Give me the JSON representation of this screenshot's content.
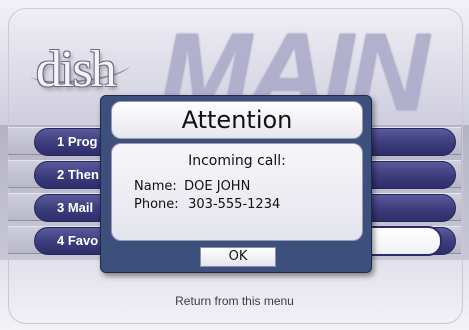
{
  "app": {
    "logo_text": "dish",
    "screen_title": "MAIN"
  },
  "menu": {
    "items": [
      {
        "label": "1 Prog"
      },
      {
        "label": "2 Then"
      },
      {
        "label": "3 Mail"
      },
      {
        "label": "4 Favo"
      }
    ],
    "selected_index": 3
  },
  "footer": {
    "text": "Return from this menu"
  },
  "dialog": {
    "title": "Attention",
    "heading": "Incoming call:",
    "name_label": "Name:",
    "name_value": "DOE JOHN",
    "phone_label": "Phone:",
    "phone_value": "303-555-1234",
    "ok_label": "OK"
  },
  "colors": {
    "dialog_frame": "#3d4f7d",
    "menu_pill": "#3c3c7c",
    "title_watermark": "#a9a8c8"
  }
}
